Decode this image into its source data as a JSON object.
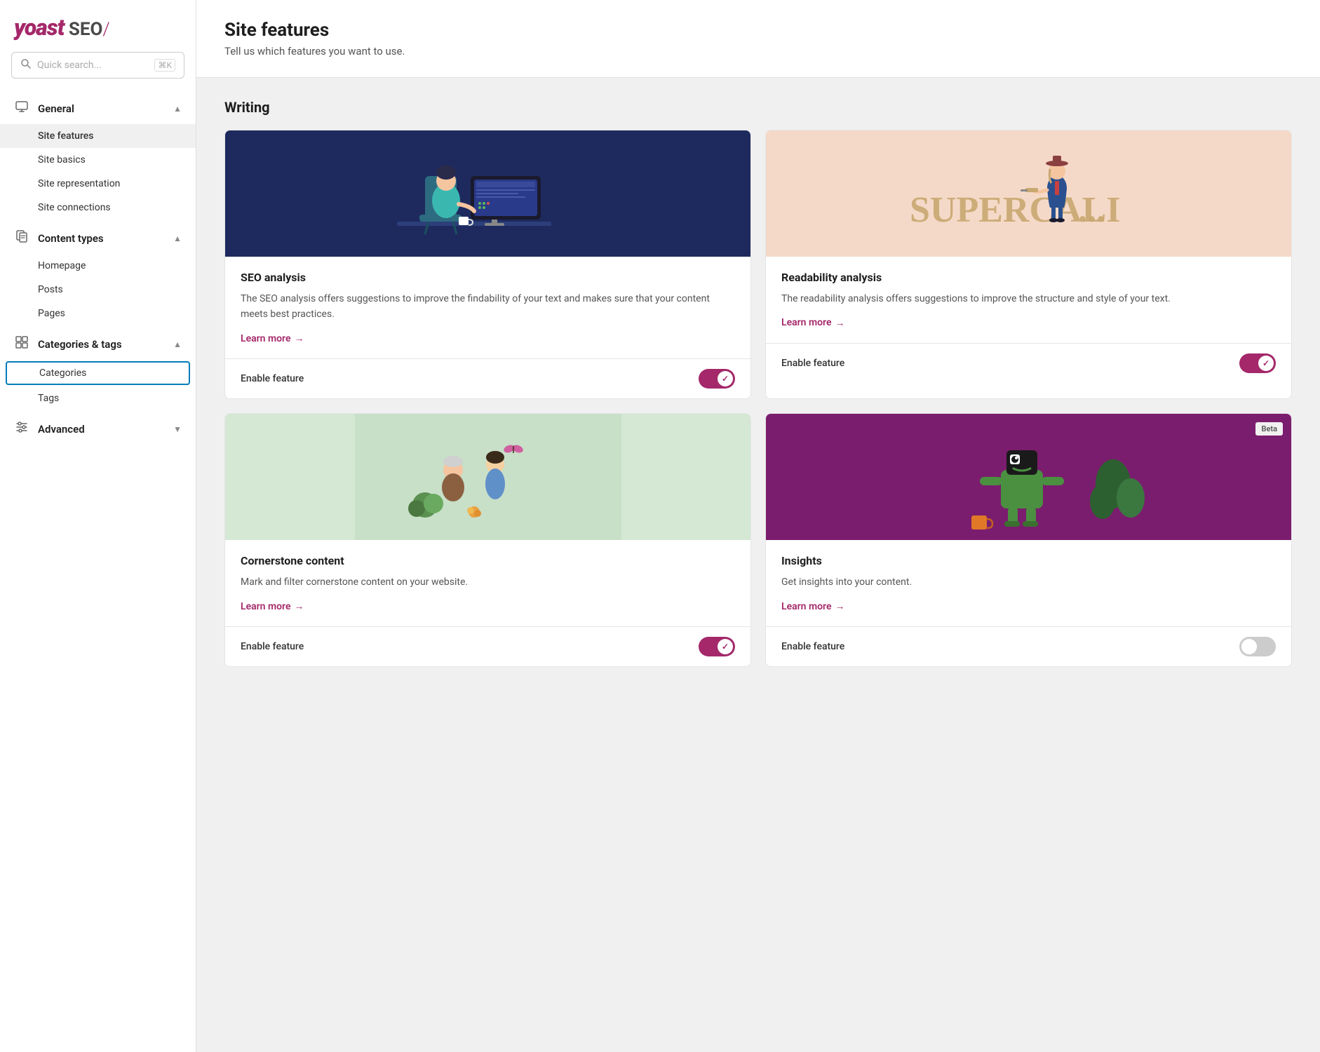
{
  "logo": {
    "brand": "yoast",
    "product": "SEO",
    "slash": "/"
  },
  "search": {
    "placeholder": "Quick search...",
    "shortcut": "⌘K"
  },
  "sidebar": {
    "sections": [
      {
        "id": "general",
        "icon": "monitor",
        "title": "General",
        "expanded": true,
        "items": [
          {
            "id": "site-features",
            "label": "Site features",
            "active": true
          },
          {
            "id": "site-basics",
            "label": "Site basics",
            "active": false
          },
          {
            "id": "site-representation",
            "label": "Site representation",
            "active": false
          },
          {
            "id": "site-connections",
            "label": "Site connections",
            "active": false
          }
        ]
      },
      {
        "id": "content-types",
        "icon": "document",
        "title": "Content types",
        "expanded": true,
        "items": [
          {
            "id": "homepage",
            "label": "Homepage",
            "active": false
          },
          {
            "id": "posts",
            "label": "Posts",
            "active": false
          },
          {
            "id": "pages",
            "label": "Pages",
            "active": false
          }
        ]
      },
      {
        "id": "categories-tags",
        "icon": "tag",
        "title": "Categories & tags",
        "expanded": true,
        "items": [
          {
            "id": "categories",
            "label": "Categories",
            "active": false,
            "highlighted": true
          },
          {
            "id": "tags",
            "label": "Tags",
            "active": false
          }
        ]
      },
      {
        "id": "advanced",
        "icon": "sliders",
        "title": "Advanced",
        "expanded": false,
        "items": []
      }
    ]
  },
  "page": {
    "title": "Site features",
    "subtitle": "Tell us which features you want to use."
  },
  "sections": [
    {
      "id": "writing",
      "heading": "Writing",
      "cards": [
        {
          "id": "seo-analysis",
          "title": "SEO analysis",
          "description": "The SEO analysis offers suggestions to improve the findability of your text and makes sure that your content meets best practices.",
          "learn_more": "Learn more",
          "enable_label": "Enable feature",
          "enabled": true,
          "illustration_type": "seo",
          "beta": false
        },
        {
          "id": "readability-analysis",
          "title": "Readability analysis",
          "description": "The readability analysis offers suggestions to improve the structure and style of your text.",
          "learn_more": "Learn more",
          "enable_label": "Enable feature",
          "enabled": true,
          "illustration_type": "readability",
          "beta": false
        },
        {
          "id": "cornerstones",
          "title": "Cornerstone content",
          "description": "Mark and filter cornerstone content on your website.",
          "learn_more": "Learn more",
          "enable_label": "Enable feature",
          "enabled": true,
          "illustration_type": "cornerstones",
          "beta": false
        },
        {
          "id": "insights",
          "title": "Insights",
          "description": "Get insights into your content.",
          "learn_more": "Learn more",
          "enable_label": "Enable feature",
          "enabled": false,
          "illustration_type": "insights",
          "beta": true
        }
      ]
    }
  ],
  "arrow": "→"
}
